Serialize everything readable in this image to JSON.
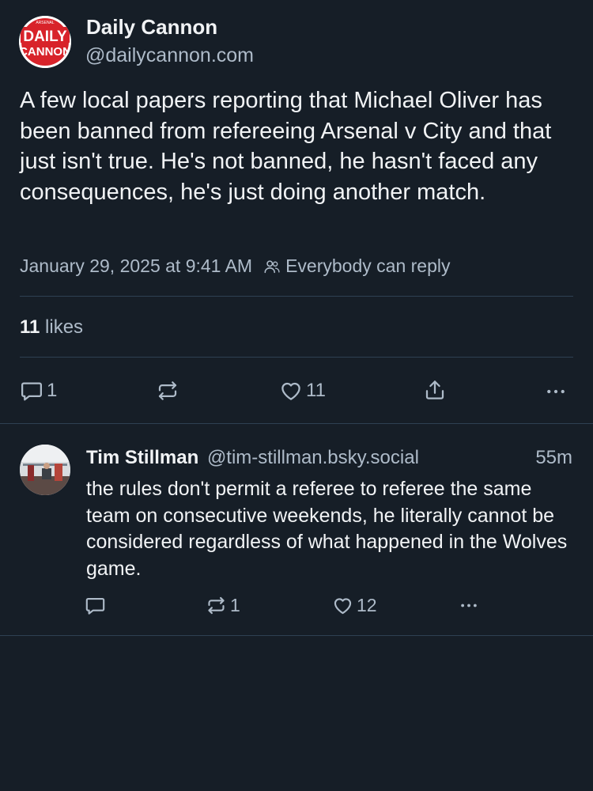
{
  "post": {
    "author_name": "Daily Cannon",
    "author_handle": "@dailycannon.com",
    "avatar_text_top": "DAILY",
    "avatar_text_bottom": "CANNON",
    "avatar_arc_text": "ARSENAL",
    "text": "A few local papers reporting that Michael Oliver has been banned from refereeing Arsenal v City and that just isn't true. He's not banned, he hasn't faced any consequences, he's just doing another match.",
    "timestamp": "January 29, 2025 at 9:41 AM",
    "reply_setting": "Everybody can reply",
    "likes_count": "11",
    "likes_label": "likes",
    "actions": {
      "reply_count": "1",
      "repost_count": "",
      "like_count": "11"
    }
  },
  "reply": {
    "author_name": "Tim Stillman",
    "author_handle": "@tim-stillman.bsky.social",
    "time": "55m",
    "text": "the rules don't permit a referee to referee the same team on consecutive weekends, he literally cannot be considered regardless of what happened in the Wolves game.",
    "actions": {
      "reply_count": "",
      "repost_count": "1",
      "like_count": "12"
    }
  },
  "icons": {
    "reply": "reply-bubble-icon",
    "repost": "repost-icon",
    "like": "heart-icon",
    "share": "share-icon",
    "more": "more-dots-icon",
    "people": "people-icon"
  },
  "colors": {
    "background": "#161e27",
    "text": "#f1f3f5",
    "muted": "#aebbc9",
    "divider": "#2e4052",
    "brand_red": "#d8232a"
  }
}
